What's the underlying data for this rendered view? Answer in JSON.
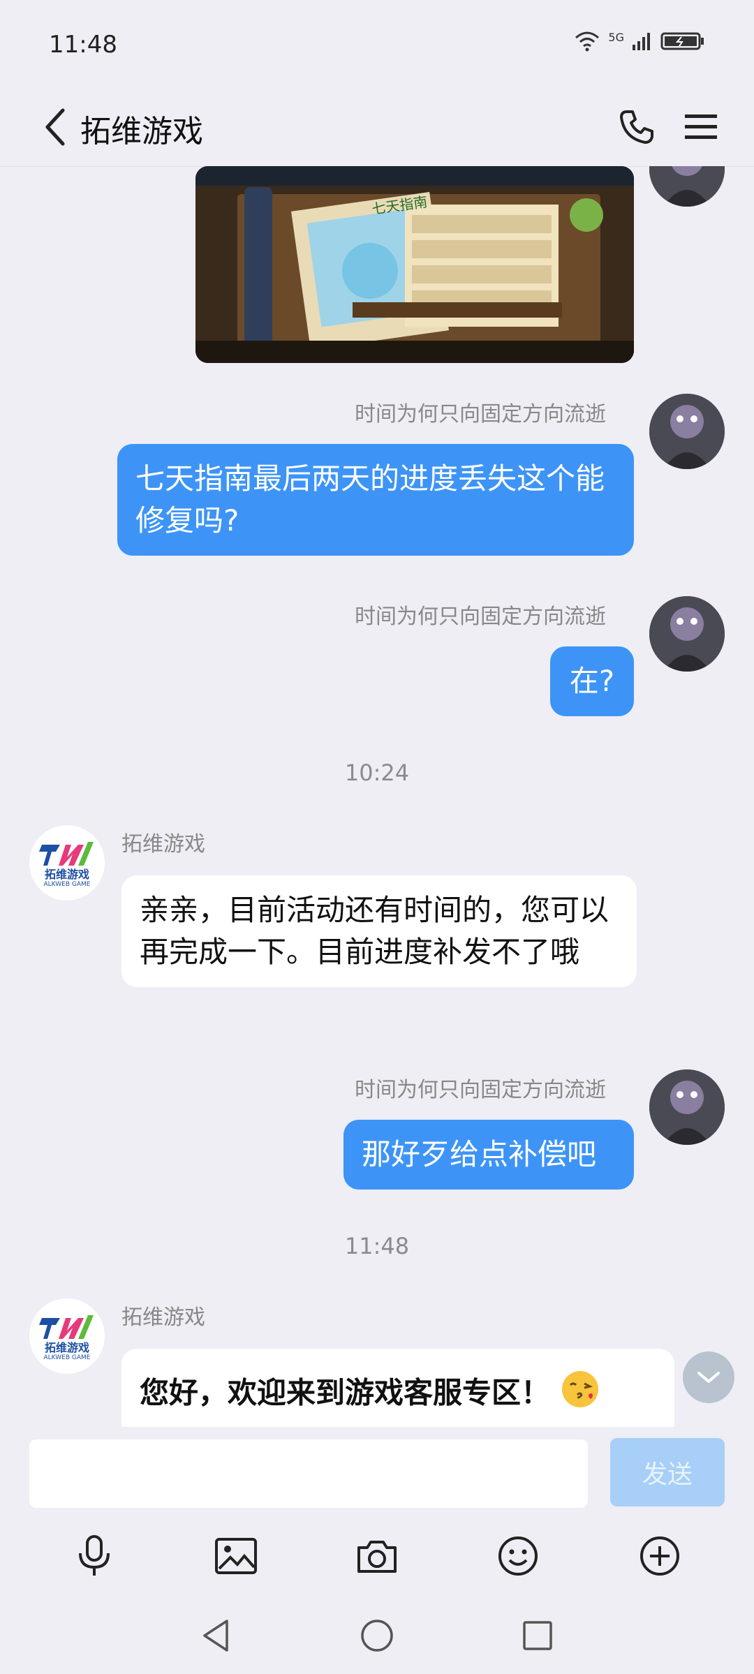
{
  "status_bar": {
    "time": "11:48",
    "network": "5G"
  },
  "header": {
    "title": "拓维游戏"
  },
  "messages": {
    "user_name": "时间为何只向固定方向流逝",
    "bot_name": "拓维游戏",
    "msg1": "七天指南最后两天的进度丢失这个能修复吗?",
    "msg2": "在?",
    "time1": "10:24",
    "msg3": "亲亲，目前活动还有时间的，您可以再完成一下。目前进度补发不了哦",
    "msg4": "那好歹给点补偿吧",
    "time2": "11:48",
    "msg5": "您好，欢迎来到游戏客服专区！",
    "bot_logo_text": "拓维游戏",
    "bot_logo_sub": "ALKWEB GAME",
    "game_banner_text": "七天指南"
  },
  "input": {
    "placeholder": "",
    "send_label": "发送"
  },
  "colors": {
    "accent": "#3d94f6",
    "background": "#eeeef4",
    "send_disabled": "#a7cff7"
  }
}
